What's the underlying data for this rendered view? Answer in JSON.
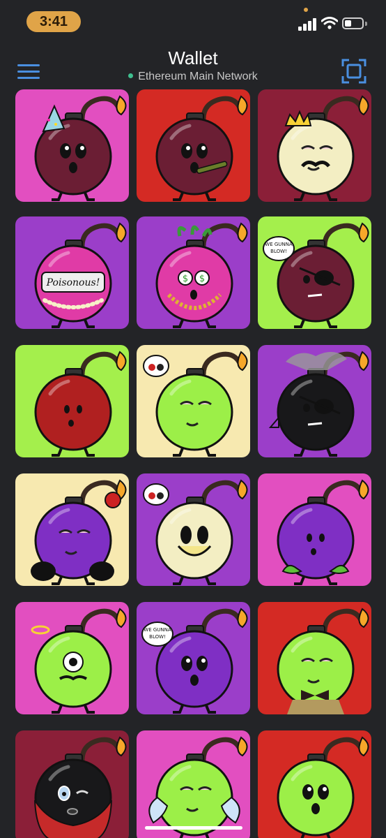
{
  "status_bar": {
    "time": "3:41"
  },
  "header": {
    "title": "Wallet",
    "network": "Ethereum Main Network",
    "network_dot_color": "#3fbf8f",
    "menu_icon": "hamburger-menu-icon",
    "scan_icon": "qr-scan-icon",
    "accent_color": "#4a8fe0"
  },
  "nfts": [
    {
      "bg": "#e24fc0",
      "bomb": "#6b1e34",
      "eyes": "normal",
      "extra": "party-hat"
    },
    {
      "bg": "#d42a24",
      "bomb": "#6b1e34",
      "eyes": "normal",
      "extra": "cigar"
    },
    {
      "bg": "#8b1f38",
      "bomb": "#f3eec3",
      "eyes": "sleepy",
      "extra": "crown"
    },
    {
      "bg": "#9b3ec9",
      "bomb": "#e03ba6",
      "eyes": "none",
      "extra": "label",
      "label_text": "Poisonous!"
    },
    {
      "bg": "#9b3ec9",
      "bomb": "#e03ba6",
      "eyes": "dollar",
      "extra": "chain"
    },
    {
      "bg": "#a4ef4c",
      "bomb": "#6b1e34",
      "eyes": "patch",
      "extra": "bubble",
      "bubble_text": "WE GUNNA BLOW!"
    },
    {
      "bg": "#a4ef4c",
      "bomb": "#b02020",
      "eyes": "small",
      "extra": "none"
    },
    {
      "bg": "#f7e9b0",
      "bomb": "#9cef48",
      "eyes": "sleepy",
      "extra": "cherry"
    },
    {
      "bg": "#9b3ec9",
      "bomb": "#18181a",
      "eyes": "patch",
      "extra": "smoke"
    },
    {
      "bg": "#f7e9b0",
      "bomb": "#7f2fc4",
      "eyes": "sleepy",
      "extra": "boots"
    },
    {
      "bg": "#9b3ec9",
      "bomb": "#f3eec3",
      "eyes": "mask",
      "extra": "cherry"
    },
    {
      "bg": "#e24fc0",
      "bomb": "#7f2fc4",
      "eyes": "small",
      "extra": "leaves"
    },
    {
      "bg": "#e24fc0",
      "bomb": "#9cef48",
      "eyes": "cyclops",
      "extra": "halo"
    },
    {
      "bg": "#9b3ec9",
      "bomb": "#7f2fc4",
      "eyes": "normal",
      "extra": "bubble",
      "bubble_text": "WE GUNNA BLOW!"
    },
    {
      "bg": "#d42a24",
      "bomb": "#9cef48",
      "eyes": "sleepy",
      "extra": "bowtie"
    },
    {
      "bg": "#8b1f38",
      "bomb": "#18181a",
      "eyes": "wink",
      "extra": "cape"
    },
    {
      "bg": "#e24fc0",
      "bomb": "#9cef48",
      "eyes": "sleepy",
      "extra": "wings"
    },
    {
      "bg": "#d42a24",
      "bomb": "#9cef48",
      "eyes": "normal",
      "extra": "none"
    }
  ]
}
